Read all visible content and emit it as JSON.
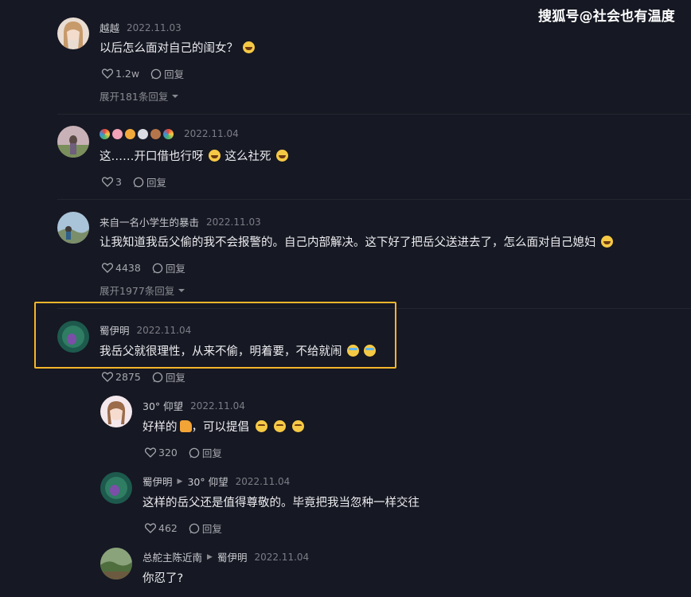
{
  "watermark": "搜狐号@社会也有温度",
  "comments": [
    {
      "username": "越越",
      "date": "2022.11.03",
      "text": "以后怎么面对自己的闺女？",
      "likes": "1.2w",
      "reply_label": "回复",
      "expand": "展开181条回复"
    },
    {
      "username_emoji": [
        "rainbow-emoji",
        "pig-emoji",
        "tiger-emoji",
        "rabbit-emoji",
        "bear-emoji",
        "rainbow-emoji"
      ],
      "date": "2022.11.04",
      "text_a": "这……开口借也行呀",
      "text_b": "这么社死",
      "likes": "3",
      "reply_label": "回复"
    },
    {
      "username": "来自一名小学生的暴击",
      "date": "2022.11.03",
      "text": "让我知道我岳父偷的我不会报警的。自己内部解决。这下好了把岳父送进去了，怎么面对自己媳妇",
      "likes": "4438",
      "reply_label": "回复",
      "expand": "展开1977条回复"
    },
    {
      "username": "蜀伊明",
      "date": "2022.11.04",
      "text": "我岳父就很理性，从来不偷，明着要，不给就闹",
      "likes": "2875",
      "reply_label": "回复"
    }
  ],
  "replies": [
    {
      "username": "30° 仰望",
      "date": "2022.11.04",
      "text_a": "好样的",
      "text_b": "，可以提倡",
      "likes": "320",
      "reply_label": "回复"
    },
    {
      "username": "蜀伊明",
      "reply_to": "30° 仰望",
      "date": "2022.11.04",
      "text": "这样的岳父还是值得尊敬的。毕竟把我当忽种一样交往",
      "likes": "462",
      "reply_label": "回复"
    },
    {
      "username": "总舵主陈近南",
      "reply_to": "蜀伊明",
      "date": "2022.11.04",
      "text": "你忍了?"
    }
  ],
  "colors": {
    "background": "#161823",
    "highlight": "#f3b62a"
  }
}
